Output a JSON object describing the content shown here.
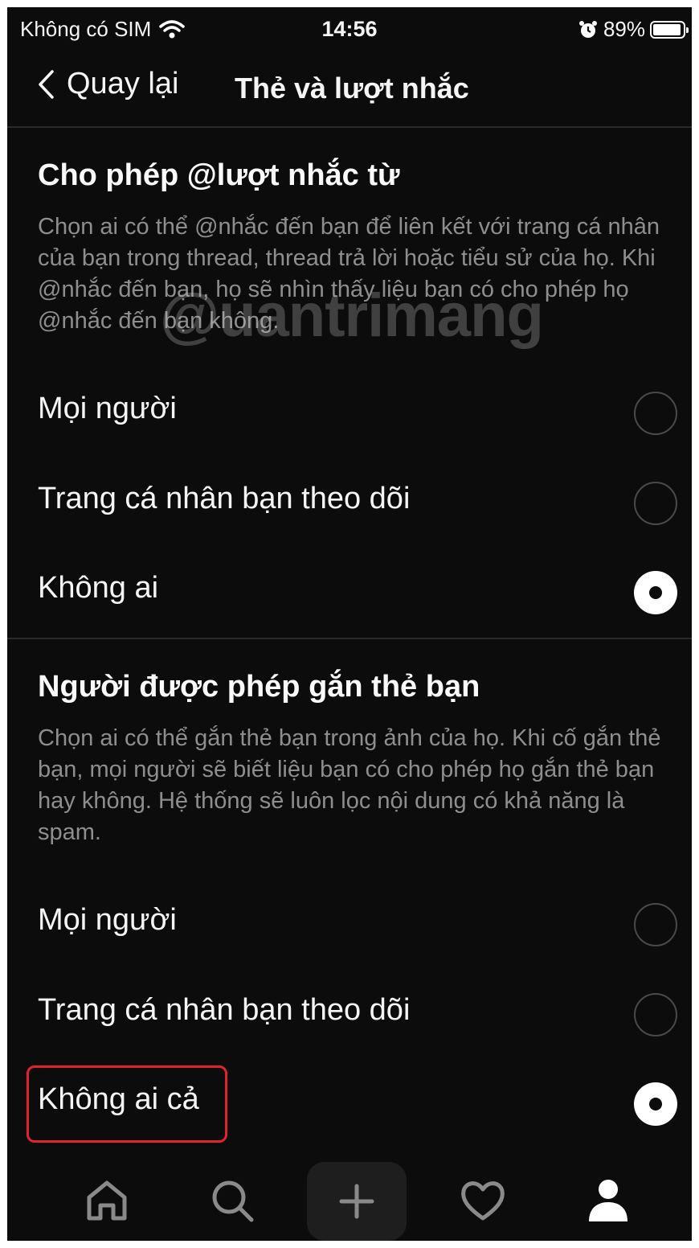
{
  "status_bar": {
    "carrier": "Không có SIM",
    "time": "14:56",
    "battery": "89%"
  },
  "nav": {
    "back_label": "Quay lại",
    "title": "Thẻ và lượt nhắc"
  },
  "mentions": {
    "title": "Cho phép @lượt nhắc từ",
    "description": "Chọn ai có thể @nhắc đến bạn để liên kết với trang cá nhân của bạn trong thread, thread trả lời hoặc tiểu sử của họ. Khi @nhắc đến bạn, họ sẽ nhìn thấy liệu bạn có cho phép họ @nhắc đến bạn không.",
    "options": [
      {
        "label": "Mọi người",
        "selected": false
      },
      {
        "label": "Trang cá nhân bạn theo dõi",
        "selected": false
      },
      {
        "label": "Không ai",
        "selected": true
      }
    ]
  },
  "tags": {
    "title": "Người được phép gắn thẻ bạn",
    "description": "Chọn ai có thể gắn thẻ bạn trong ảnh của họ. Khi cố gắn thẻ bạn, mọi người sẽ biết liệu bạn có cho phép họ gắn thẻ bạn hay không. Hệ thống sẽ luôn lọc nội dung có khả năng là spam.",
    "options": [
      {
        "label": "Mọi người",
        "selected": false
      },
      {
        "label": "Trang cá nhân bạn theo dõi",
        "selected": false
      },
      {
        "label": "Không ai cả",
        "selected": true
      }
    ]
  },
  "watermark": "@uantrimang",
  "highlight_color": "#e0242e",
  "tabbar": [
    "home-icon",
    "search-icon",
    "plus-icon",
    "heart-icon",
    "profile-icon"
  ]
}
